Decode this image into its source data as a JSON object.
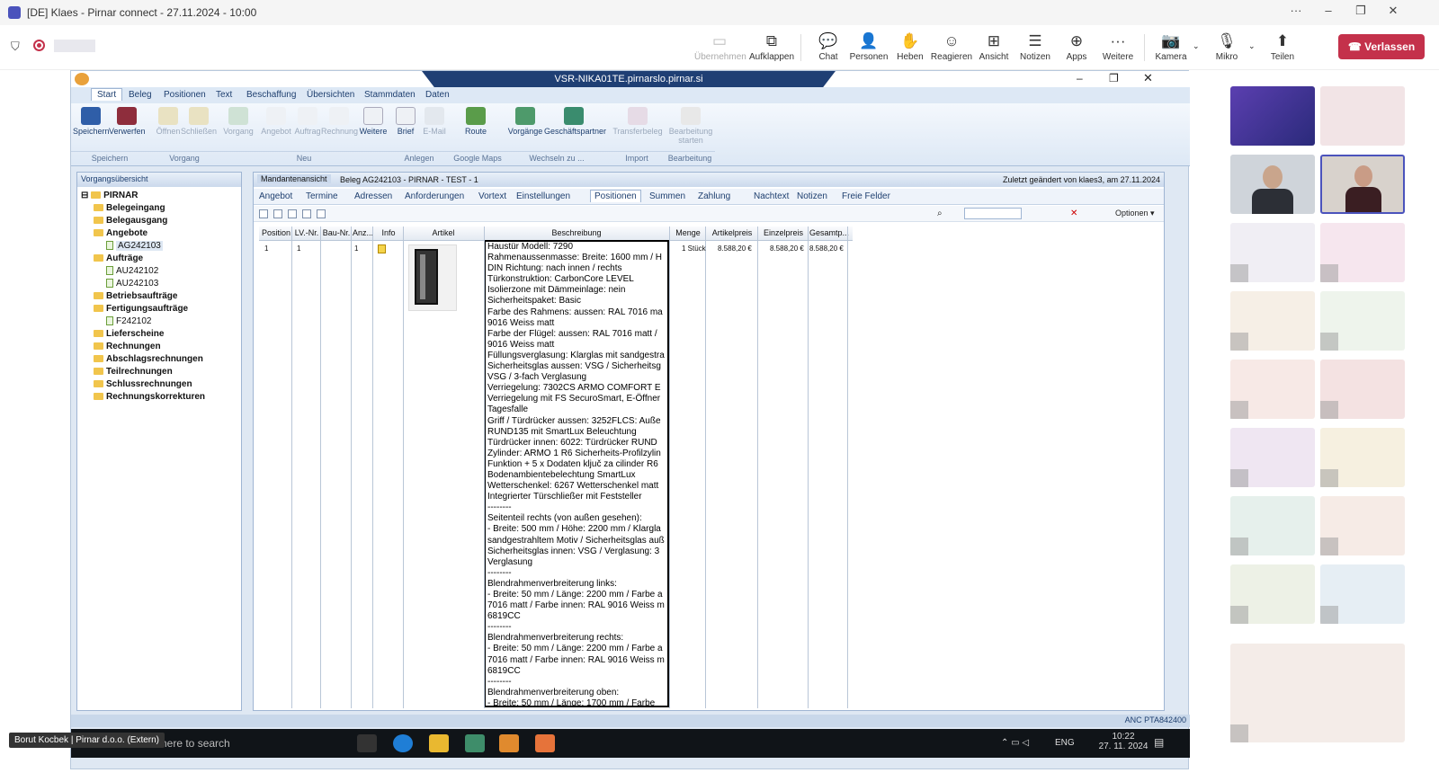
{
  "teams": {
    "window_title": "[DE] Klaes - Pirnar connect - 27.11.2024 - 10:00",
    "toolbar": [
      {
        "label": "Übernehmen",
        "icon": "share-screen-icon",
        "disabled": true
      },
      {
        "label": "Aufklappen",
        "icon": "popout-icon"
      },
      {
        "label": "Chat",
        "icon": "chat-icon"
      },
      {
        "label": "Personen",
        "icon": "people-icon"
      },
      {
        "label": "Heben",
        "icon": "raise-hand-icon"
      },
      {
        "label": "Reagieren",
        "icon": "react-icon"
      },
      {
        "label": "Ansicht",
        "icon": "view-grid-icon"
      },
      {
        "label": "Notizen",
        "icon": "notes-icon"
      },
      {
        "label": "Apps",
        "icon": "apps-icon"
      },
      {
        "label": "Weitere",
        "icon": "more-icon"
      },
      {
        "label": "Kamera",
        "icon": "camera-off-icon"
      },
      {
        "label": "Mikro",
        "icon": "mic-off-icon"
      },
      {
        "label": "Teilen",
        "icon": "share-icon"
      }
    ],
    "leave_label": "Verlassen",
    "participant_badge": "Borut Kocbek | Pirnar d.o.o. (Extern)",
    "accent": "#c4314b"
  },
  "remote": {
    "rdp_title": "VSR-NIKA01TE.pirnarslo.pirnar.si",
    "menu": [
      "Start",
      "Beleg",
      "Positionen",
      "Text",
      "Beschaffung",
      "Übersichten",
      "Stammdaten",
      "Daten"
    ],
    "ribbon": {
      "buttons": [
        "Speichern",
        "Verwerfen",
        "Öffnen",
        "Schließen",
        "Vorgang",
        "Angebot",
        "Auftrag",
        "Rechnung",
        "Weitere",
        "Brief",
        "E-Mail",
        "Route",
        "Vorgänge",
        "Geschäftspartner",
        "Transferbeleg",
        "Bearbeitung starten"
      ],
      "groups": [
        "Speichern",
        "Vorgang",
        "Neu",
        "Anlegen",
        "Google Maps",
        "Wechseln zu ...",
        "Import",
        "Bearbeitung"
      ]
    },
    "tree": {
      "header": "Vorgangsübersicht",
      "root": "PIRNAR",
      "items": [
        {
          "label": "Belegeingang",
          "level": 1,
          "bold": true
        },
        {
          "label": "Belegausgang",
          "level": 1,
          "bold": true
        },
        {
          "label": "Angebote",
          "level": 1,
          "bold": true
        },
        {
          "label": "AG242103",
          "level": 2,
          "selected": true
        },
        {
          "label": "Aufträge",
          "level": 1,
          "bold": true
        },
        {
          "label": "AU242102",
          "level": 2
        },
        {
          "label": "AU242103",
          "level": 2
        },
        {
          "label": "Betriebsaufträge",
          "level": 1,
          "bold": true
        },
        {
          "label": "Fertigungsaufträge",
          "level": 1,
          "bold": true
        },
        {
          "label": "F242102",
          "level": 2
        },
        {
          "label": "Lieferscheine",
          "level": 1,
          "bold": true
        },
        {
          "label": "Rechnungen",
          "level": 1,
          "bold": true
        },
        {
          "label": "Abschlagsrechnungen",
          "level": 1,
          "bold": true
        },
        {
          "label": "Teilrechnungen",
          "level": 1,
          "bold": true
        },
        {
          "label": "Schlussrechnungen",
          "level": 1,
          "bold": true
        },
        {
          "label": "Rechnungskorrekturen",
          "level": 1,
          "bold": true
        }
      ]
    },
    "main": {
      "header_tab": "Mandantenansicht",
      "beleg": "Beleg AG242103 - PIRNAR - TEST - 1",
      "last_changed": "Zuletzt geändert von klaes3, am 27.11.2024",
      "tabs": [
        "Angebot",
        "Termine",
        "Adressen",
        "Anforderungen",
        "Vortext",
        "Einstellungen",
        "Positionen",
        "Summen",
        "Zahlung",
        "Nachtext",
        "Notizen",
        "Freie Felder"
      ],
      "active_tab": "Positionen",
      "options_label": "Optionen",
      "columns": [
        "Position",
        "LV.-Nr.",
        "Bau-Nr.",
        "Anz...",
        "Info",
        "Artikel",
        "Beschreibung",
        "Menge",
        "Artikelpreis",
        "Einzelpreis",
        "Gesamtp..."
      ],
      "row": {
        "position": "1",
        "lv": "1",
        "anz": "1",
        "menge": "1 Stück",
        "artikelpreis": "8.588,20 €",
        "einzelpreis": "8.588,20 €",
        "gesamtpreis": "8.588,20 €"
      },
      "description_lines": [
        "Haustür Modell: 7290",
        "Rahmenaussenmasse: Breite: 1600 mm / H",
        "DIN Richtung: nach innen / rechts",
        "Türkonstruktion: CarbonCore LEVEL",
        "Isolierzone mit Dämmeinlage: nein",
        "Sicherheitspaket: Basic",
        "Farbe des Rahmens: aussen: RAL 7016 ma",
        "9016 Weiss matt",
        "Farbe der Flügel: aussen: RAL 7016 matt /",
        "9016 Weiss matt",
        "Füllungsverglasung: Klarglas mit sandgestra",
        "Sicherheitsglas aussen: VSG / Sicherheitsg",
        "VSG / 3-fach Verglasung",
        "Verriegelung: 7302CS ARMO COMFORT E",
        "Verriegelung mit FS SecuroSmart, E-Öffner",
        "Tagesfalle",
        "Griff / Türdrücker aussen: 3252FLCS: Auße",
        "RUND135 mit SmartLux Beleuchtung",
        "Türdrücker innen: 6022: Türdrücker RUND",
        "Zylinder: ARMO 1 R6 Sicherheits-Profilzylin",
        "Funktion + 5 x Dodaten ključ za cilinder R6",
        "Bodenambientebelechtung SmartLux",
        "Wetterschenkel: 6267 Wetterschenkel matt",
        "Integrierter Türschließer mit Feststeller",
        "--------",
        "Seitenteil rechts (von außen gesehen):",
        "- Breite: 500 mm / Höhe: 2200 mm / Klargla",
        "sandgestrahltem Motiv / Sicherheitsglas auß",
        "Sicherheitsglas innen: VSG / Verglasung: 3",
        "Verglasung",
        "--------",
        "Blendrahmenverbreiterung links:",
        "- Breite: 50 mm / Länge: 2200 mm / Farbe a",
        "7016 matt / Farbe innen: RAL 9016 Weiss m",
        "6819CC",
        "--------",
        "Blendrahmenverbreiterung rechts:",
        "- Breite: 50 mm / Länge: 2200 mm / Farbe a",
        "7016 matt / Farbe innen: RAL 9016 Weiss m",
        "6819CC",
        "--------",
        "Blendrahmenverbreiterung oben:",
        "- Breite: 50 mm / Länge: 1700 mm / Farbe"
      ]
    },
    "status_right": "ANC PTA842400",
    "taskbar": {
      "search_placeholder": "here to search",
      "lang": "ENG",
      "time": "10:22",
      "date": "27. 11. 2024"
    }
  }
}
